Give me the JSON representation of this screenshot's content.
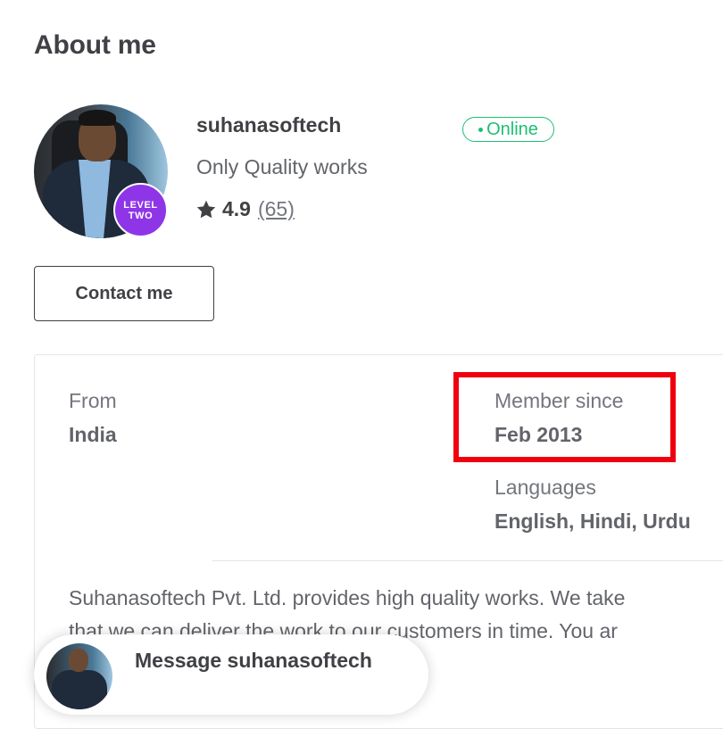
{
  "section": {
    "title": "About me"
  },
  "profile": {
    "username": "suhanasoftech",
    "status": "Online",
    "tagline": "Only Quality works",
    "rating": "4.9",
    "review_count": "(65)",
    "level_line1": "LEVEL",
    "level_line2": "TWO"
  },
  "actions": {
    "contact_label": "Contact me"
  },
  "stats": {
    "from_label": "From",
    "from_value": "India",
    "member_since_label": "Member since",
    "member_since_value": "Feb 2013",
    "languages_label": "Languages",
    "languages_value": "English, Hindi, Urdu"
  },
  "description": {
    "line1": "Suhanasoftech Pvt. Ltd. provides high quality works. We take",
    "line2": "that we can deliver the work to our customers in time. You ar"
  },
  "message": {
    "label": "Message suhanasoftech"
  },
  "colors": {
    "accent_green": "#1dbf73",
    "level_purple": "#8f35e8",
    "highlight_red": "#f0000f",
    "text_dark": "#404145"
  },
  "icons": {
    "rating": "star-icon",
    "status": "online-dot-icon"
  }
}
